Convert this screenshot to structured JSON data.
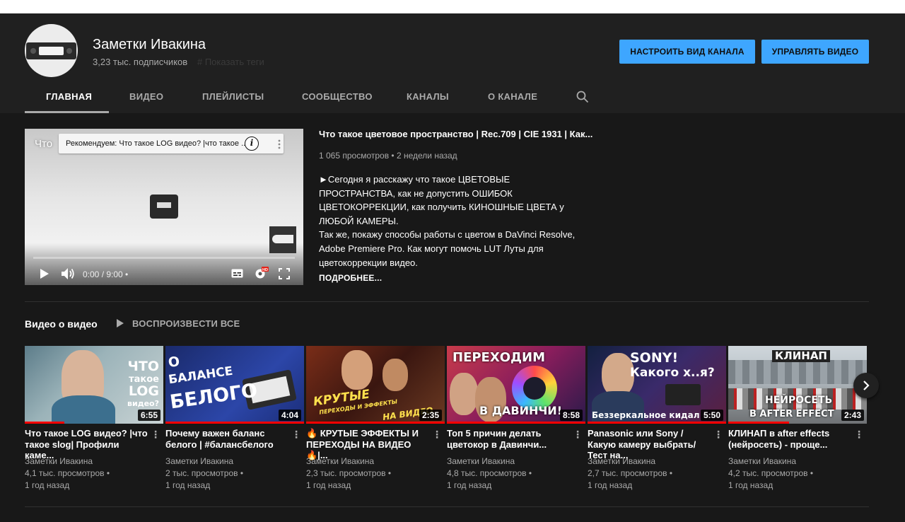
{
  "channel": {
    "name": "Заметки Ивакина",
    "subscribers": "3,23 тыс. подписчиков",
    "tags_link": "# Показать теги"
  },
  "buttons": {
    "customize": "НАСТРОИТЬ ВИД КАНАЛА",
    "manage": "УПРАВЛЯТЬ ВИДЕО"
  },
  "tabs": [
    {
      "label": "ГЛАВНАЯ",
      "active": true
    },
    {
      "label": "ВИДЕО"
    },
    {
      "label": "ПЛЕЙЛИСТЫ"
    },
    {
      "label": "СООБЩЕСТВО"
    },
    {
      "label": "КАНАЛЫ"
    },
    {
      "label": "О КАНАЛЕ"
    }
  ],
  "player": {
    "title_prefix": "Что",
    "recommend": "Рекомендуем: Что такое LOG видео? |что такое ...",
    "time": "0:00 / 9:00 •"
  },
  "featured": {
    "title": "Что такое цветовое пространство | Rec.709 | CIE 1931 | Как...",
    "meta": "1 065 просмотров • 2 недели назад",
    "description": "►Сегодня я расскажу что такое ЦВЕТОВЫЕ ПРОСТРАНСТВА, как не допустить ОШИБОК ЦВЕТОКОРРЕКЦИИ, как получить КИНОШНЫЕ ЦВЕТА у ЛЮБОЙ КАМЕРЫ.\nТак же, покажу способы работы с цветом в DaVinci Resolve, Adobe Premiere Pro. Как могут помочь LUT Луты для цветокоррекции видео.",
    "more": "ПОДРОБНЕЕ..."
  },
  "shelf": {
    "title": "Видео о видео",
    "play_all": "ВОСПРОИЗВЕСТИ ВСЕ",
    "videos": [
      {
        "title": "Что такое LOG видео? |что такое slog| Профили каме...",
        "channel": "Заметки Ивакина",
        "views": "4,1 тыс. просмотров •",
        "age": "1 год назад",
        "duration": "6:55",
        "thumb_text": [
          "ЧТО",
          "такое",
          "LOG",
          "видео?"
        ]
      },
      {
        "title": "Почему важен баланс белого | #балансбелого",
        "channel": "Заметки Ивакина",
        "views": "2 тыс. просмотров •",
        "age": "1 год назад",
        "duration": "4:04",
        "thumb_text": [
          "О",
          "БАЛАНСЕ",
          "БЕЛОГО"
        ]
      },
      {
        "title": "🔥 КРУТЫЕ ЭФФЕКТЫ И ПЕРЕХОДЫ НА ВИДЕО 🔥|...",
        "channel": "Заметки Ивакина",
        "views": "2,3 тыс. просмотров •",
        "age": "1 год назад",
        "duration": "2:35",
        "thumb_text": [
          "КРУТЫЕ",
          "ПЕРЕХОДЫ И ЭФФЕКТЫ",
          "НА ВИДЕО"
        ]
      },
      {
        "title": "Топ 5 причин делать цветокор в Давинчи...",
        "channel": "Заметки Ивакина",
        "views": "4,8 тыс. просмотров •",
        "age": "1 год назад",
        "duration": "8:58",
        "thumb_text": [
          "ПЕРЕХОДИМ",
          "В ДАВИНЧИ!"
        ]
      },
      {
        "title": "Panasonic или Sony / Какую камеру выбрать/ Тест на...",
        "channel": "Заметки Ивакина",
        "views": "2,7 тыс. просмотров •",
        "age": "1 год назад",
        "duration": "5:50",
        "thumb_text": [
          "SONY!",
          "Какого х..я?",
          "Беззеркальное кидал"
        ]
      },
      {
        "title": "КЛИНАП в after effects (нейросеть) - проще...",
        "channel": "Заметки Ивакина",
        "views": "4,2 тыс. просмотров •",
        "age": "1 год назад",
        "duration": "2:43",
        "thumb_text": [
          "КЛИНАП",
          "НЕЙРОСЕТЬ",
          "В AFTER EFFECT"
        ]
      }
    ]
  },
  "icons": [
    "search-icon",
    "play-icon",
    "volume-icon",
    "subtitles-icon",
    "settings-icon",
    "fullscreen-icon",
    "info-icon",
    "more-vert-icon",
    "chevron-right-icon"
  ],
  "colors": {
    "accent": "#3ea6ff",
    "header_bg": "#202020",
    "page_bg": "#181818",
    "progress_red": "#ff0000"
  }
}
